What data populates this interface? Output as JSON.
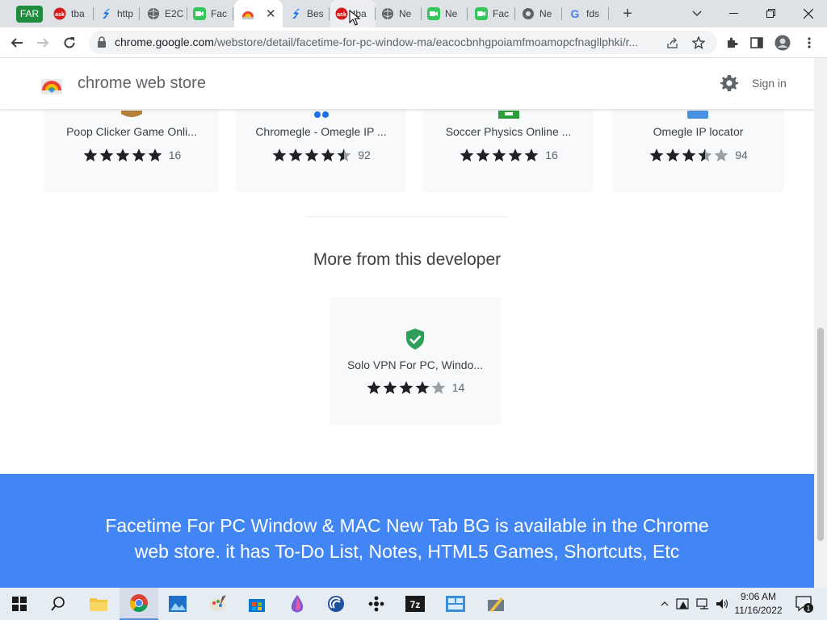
{
  "browser": {
    "tab_group_label": "FAR",
    "tabs": [
      {
        "label": "tba",
        "icon": "ask-icon"
      },
      {
        "label": "http",
        "icon": "blue-s-icon"
      },
      {
        "label": "E2C",
        "icon": "globe-icon"
      },
      {
        "label": "Fac",
        "icon": "facetime-icon"
      },
      {
        "label": "",
        "icon": "webstore-icon",
        "active": true
      },
      {
        "label": "Bes",
        "icon": "blue-s-icon"
      },
      {
        "label": "tba",
        "icon": "ask-icon",
        "hover": true
      },
      {
        "label": "Ne",
        "icon": "globe-icon"
      },
      {
        "label": "Ne",
        "icon": "facetime-icon"
      },
      {
        "label": "Fac",
        "icon": "facetime-icon"
      },
      {
        "label": "Ne",
        "icon": "chrome-icon"
      },
      {
        "label": "fds",
        "icon": "google-icon"
      }
    ],
    "new_tab_label": "+",
    "url_host": "chrome.google.com",
    "url_path": "/webstore/detail/facetime-for-pc-window-ma/eacocbnhgpoiamfmoamopcfnagllphki/r..."
  },
  "store": {
    "title": "chrome web store",
    "sign_in": "Sign in"
  },
  "related_items": [
    {
      "name": "Poop Clicker Game Onli...",
      "stars": 5,
      "count": "16"
    },
    {
      "name": "Chromegle - Omegle IP ...",
      "stars": 4.5,
      "count": "92"
    },
    {
      "name": "Soccer Physics Online ...",
      "stars": 5,
      "count": "16"
    },
    {
      "name": "Omegle IP locator",
      "stars": 3.5,
      "count": "94"
    }
  ],
  "more_from_developer": {
    "heading": "More from this developer",
    "items": [
      {
        "name": "Solo VPN For PC, Windo...",
        "stars": 4,
        "count": "14"
      }
    ]
  },
  "banner": {
    "text": "Facetime For PC Window & MAC New Tab BG is available in the Chrome web store. it has To-Do List, Notes, HTML5 Games, Shortcuts, Etc"
  },
  "taskbar": {
    "time": "9:06 AM",
    "date": "11/16/2022",
    "notification_count": "1",
    "apps": [
      "start-icon",
      "search-icon",
      "file-explorer-icon",
      "chrome-icon",
      "photos-icon",
      "paint-icon",
      "store-icon",
      "ink-icon",
      "app-icon",
      "settings-icon",
      "7zip-icon",
      "control-panel-icon",
      "tools-icon"
    ]
  },
  "colors": {
    "banner": "#4285f4",
    "tab_group": "#1e8e3e",
    "star": "#202124",
    "star_empty": "#9aa0a6"
  }
}
